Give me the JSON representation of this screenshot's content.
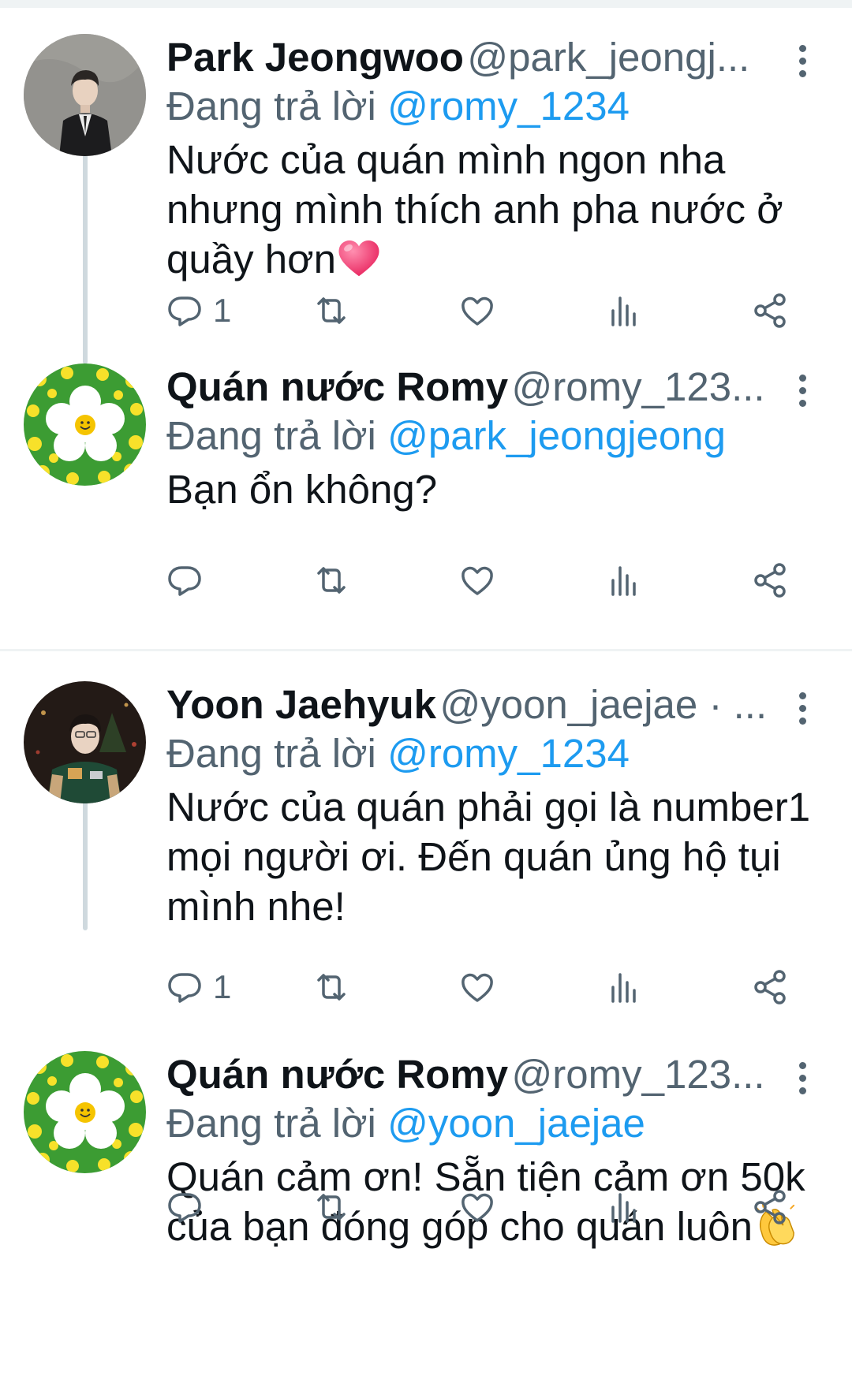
{
  "reply_prefix": "Đang trả lời",
  "tweets": [
    {
      "name": "Park Jeongwoo",
      "handle": "@park_jeongj...",
      "reply_to": "@romy_1234",
      "text": "Nước của quán mình ngon nha nhưng mình thích anh pha nước ở quầy hơn",
      "reply_count": "1",
      "emoji": "heart-emoji"
    },
    {
      "name": "Quán nước Romy",
      "handle": "@romy_123...",
      "reply_to": "@park_jeongjeong",
      "text": "Bạn ổn không?",
      "reply_count": ""
    },
    {
      "name": "Yoon Jaehyuk",
      "handle": "@yoon_jaejae · ...",
      "reply_to": "@romy_1234",
      "text": "Nước của quán phải gọi là number1 mọi người ơi. Đến quán ủng hộ tụi mình nhe!",
      "reply_count": "1"
    },
    {
      "name": "Quán nước Romy",
      "handle": "@romy_123...",
      "reply_to": "@yoon_jaejae",
      "text": "Quán cảm ơn! Sẵn tiện cảm ơn 50k của bạn đóng góp cho quán luôn",
      "reply_count": "",
      "emoji": "clapping-hands-emoji"
    }
  ],
  "colors": {
    "accent": "#1d9bf0",
    "secondary_text": "#536471",
    "divider": "#eff3f4",
    "thread_line": "#cfd9de"
  },
  "icons": [
    "reply-icon",
    "retweet-icon",
    "like-icon",
    "views-icon",
    "share-icon",
    "more-icon"
  ]
}
